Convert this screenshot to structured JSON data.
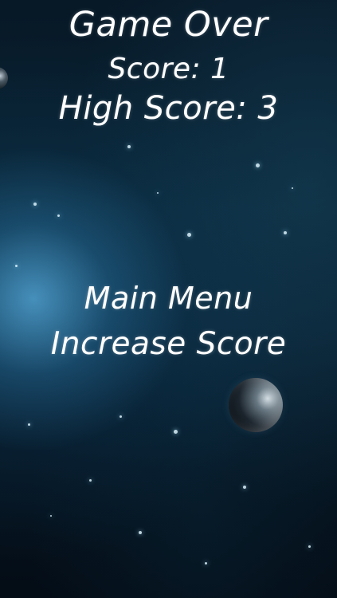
{
  "game": {
    "title": "Game Over",
    "score_text": "Score: 1",
    "high_score_text": "High Score: 3",
    "menu_text": "Main Menu",
    "increase_text": "Increase Score"
  },
  "theme": {
    "background": "#071826",
    "nebula": "#5fbef5",
    "text": "#ffffff"
  }
}
